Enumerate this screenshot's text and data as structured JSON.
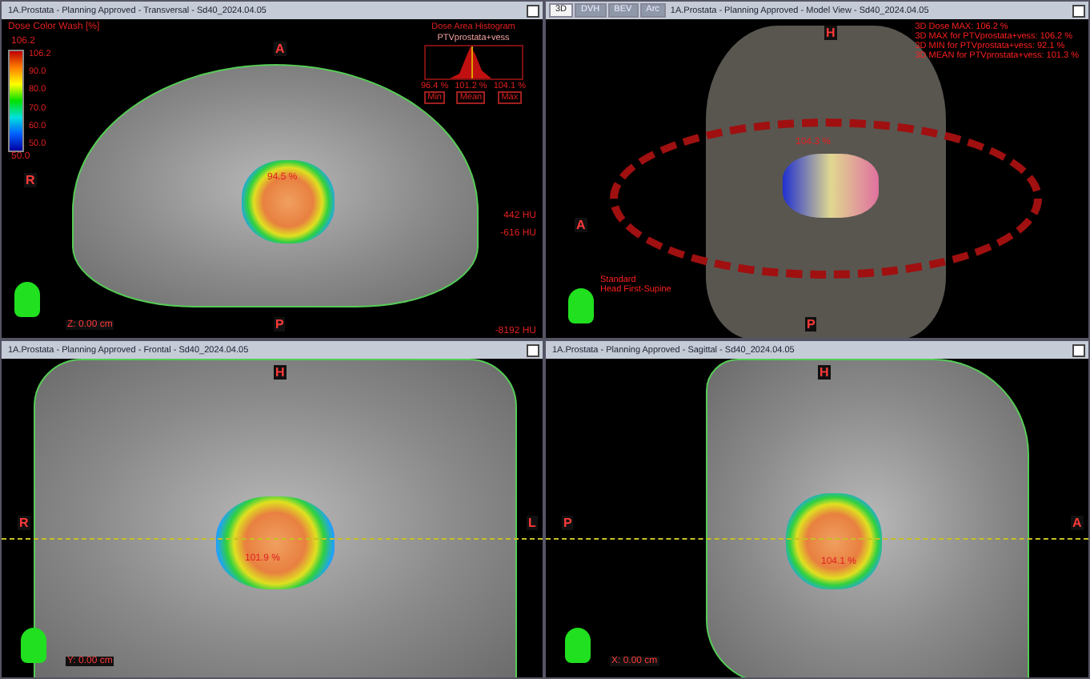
{
  "viewports": [
    {
      "kind": "transversal",
      "title": "1A.Prostata  -  Planning Approved - Transversal - Sd40_2024.04.05",
      "orientation": {
        "top": "A",
        "left": "R",
        "bottom": "P"
      },
      "dose_label": "94.5 %",
      "position": "Z: 0.00 cm",
      "legend": {
        "title": "Dose Color Wash [%]",
        "max": "106.2",
        "ticks": [
          "106.2",
          "90.0",
          "80.0",
          "70.0",
          "60.0",
          "50.0"
        ],
        "min": "50.0"
      },
      "histogram": {
        "title": "Dose Area Histogram",
        "structure": "PTVprostata+vess",
        "stats": [
          {
            "value": "96.4 %",
            "label": "Min"
          },
          {
            "value": "101.2 %",
            "label": "Mean"
          },
          {
            "value": "104.1 %",
            "label": "Max"
          }
        ]
      },
      "hu_scale": [
        "442 HU",
        "-616 HU",
        "-8192 HU"
      ]
    },
    {
      "kind": "model",
      "title": "1A.Prostata  -  Planning Approved - Model View - Sd40_2024.04.05",
      "tabs": [
        {
          "label": "3D",
          "selected": true
        },
        {
          "label": "DVH",
          "selected": false
        },
        {
          "label": "BEV",
          "selected": false
        },
        {
          "label": "Arc",
          "selected": false
        }
      ],
      "stats_lines": [
        "3D Dose MAX: 106.2 %",
        "3D MAX for PTVprostata+vess: 106.2 %",
        "3D MIN for PTVprostata+vess: 92.1 %",
        "3D MEAN for PTVprostata+vess: 101.3 %"
      ],
      "orientation": {
        "top": "H",
        "left": "A",
        "bottom": "P"
      },
      "dose_label": "104.3 %",
      "patient_orientation": [
        "Standard",
        "Head First-Supine"
      ]
    },
    {
      "kind": "frontal",
      "title": "1A.Prostata  -  Planning Approved - Frontal - Sd40_2024.04.05",
      "orientation": {
        "top": "H",
        "left": "R",
        "right": "L"
      },
      "dose_label": "101.9 %",
      "position": "Y: 0.00 cm"
    },
    {
      "kind": "sagittal",
      "title": "1A.Prostata  -  Planning Approved - Sagittal - Sd40_2024.04.05",
      "orientation": {
        "top": "H",
        "left": "P",
        "right": "A"
      },
      "dose_label": "104.1 %",
      "position": "X: 0.00 cm"
    }
  ]
}
